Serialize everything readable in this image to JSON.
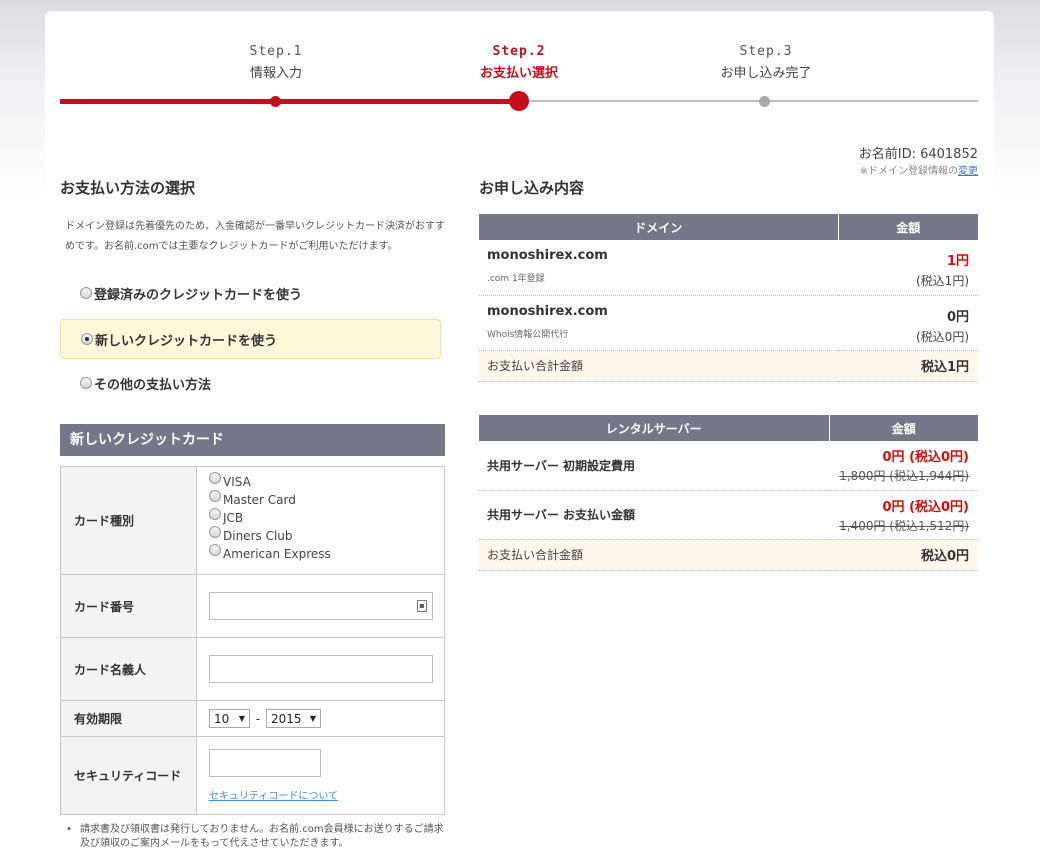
{
  "steps": [
    {
      "num": "Step.1",
      "name": "情報入力"
    },
    {
      "num": "Step.2",
      "name": "お支払い選択"
    },
    {
      "num": "Step.3",
      "name": "お申し込み完了"
    }
  ],
  "user": {
    "id_label": "お名前ID: 6401852",
    "note_prefix": "※ドメイン登録情報の",
    "note_link": "変更"
  },
  "payment": {
    "title": "お支払い方法の選択",
    "lead": "ドメイン登録は先着優先のため、入金確認が一番早いクレジットカード決済がおすすめです。お名前.comでは主要なクレジットカードがご利用いただけます。",
    "options": [
      {
        "label": "登録済みのクレジットカードを使う",
        "checked": false
      },
      {
        "label": "新しいクレジットカードを使う",
        "checked": true
      },
      {
        "label": "その他の支払い方法",
        "checked": false
      }
    ]
  },
  "card_form": {
    "title": "新しいクレジットカード",
    "type_label": "カード種別",
    "brands": [
      "VISA",
      "Master Card",
      "JCB",
      "Diners Club",
      "American Express"
    ],
    "number_label": "カード番号",
    "holder_label": "カード名義人",
    "expiry_label": "有効期限",
    "expiry_month": "10",
    "expiry_sep": "-",
    "expiry_year": "2015",
    "security_label": "セキュリティコード",
    "security_link": "セキュリティコードについて",
    "note": "請求書及び領収書は発行しておりません。お名前.com会員様にお送りするご請求及び領収のご案内メールをもって代えさせていただきます。"
  },
  "order": {
    "title": "お申し込み内容",
    "domain_table": {
      "headers": [
        "ドメイン",
        "金額"
      ],
      "rows": [
        {
          "name": "monoshirex.com",
          "sub": ".com 1年登録",
          "price": "1円",
          "tax": "(税込1円)",
          "price_red": true
        },
        {
          "name": "monoshirex.com",
          "sub": "Whois情報公開代行",
          "price": "0円",
          "tax": "(税込0円)",
          "price_red": false
        }
      ],
      "total_label": "お支払い合計金額",
      "total_value": "税込1円"
    },
    "server_table": {
      "headers": [
        "レンタルサーバー",
        "金額"
      ],
      "rows": [
        {
          "name": "共用サーバー 初期設定費用",
          "price": "0円 (税込0円)",
          "original": "1,800円 (税込1,944円)"
        },
        {
          "name": "共用サーバー お支払い金額",
          "price": "0円 (税込0円)",
          "original": "1,400円 (税込1,512円)"
        }
      ],
      "total_label": "お支払い合計金額",
      "total_value": "税込0円"
    }
  },
  "colors": {
    "accent": "#c40e1d",
    "header_bg": "#757789",
    "selected_bg": "#fcf8d9",
    "total_bg": "#fef9ec",
    "price_red": "#d60c0c"
  }
}
